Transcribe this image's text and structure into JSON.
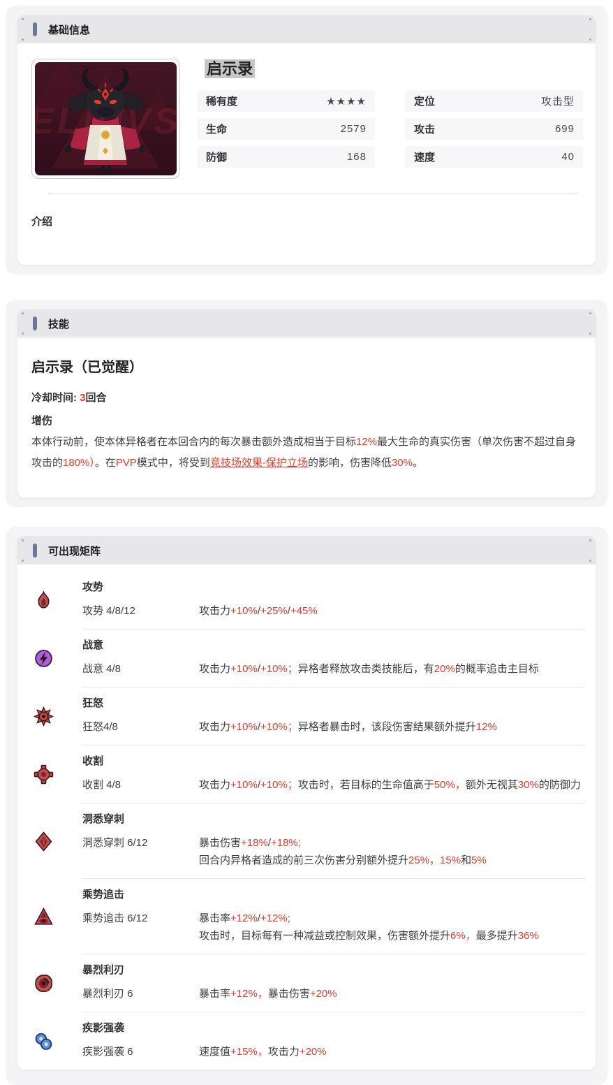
{
  "colors": {
    "accent_red": "#e8392b",
    "section_marker": "#6b7898",
    "name_highlight": "#c7c7c7",
    "header_strip": "#e7e7ea"
  },
  "basic_info": {
    "section_title": "基础信息",
    "name": "启示录",
    "portrait": {
      "watermark": "ELIUVS"
    },
    "stats_left": [
      {
        "label": "稀有度",
        "value": "★★★★"
      },
      {
        "label": "生命",
        "value": "2579"
      },
      {
        "label": "防御",
        "value": "168"
      }
    ],
    "stats_right": [
      {
        "label": "定位",
        "value": "攻击型"
      },
      {
        "label": "攻击",
        "value": "699"
      },
      {
        "label": "速度",
        "value": "40"
      }
    ],
    "intro_label": "介绍"
  },
  "skill": {
    "section_title": "技能",
    "name": "启示录（已觉醒）",
    "cooldown_label": "冷却时间:",
    "cooldown_value": "3",
    "cooldown_unit": "回合",
    "type_tag": "增伤",
    "description": [
      {
        "t": "本体行动前，使本体异格者在本回合内的每次暴击额外造成相当于目标",
        "s": "n"
      },
      {
        "t": "12%",
        "s": "r"
      },
      {
        "t": "最大生命的真实伤害（单次伤害不超过自身攻击的",
        "s": "n"
      },
      {
        "t": "180%）",
        "s": "r"
      },
      {
        "t": "。在",
        "s": "n"
      },
      {
        "t": "PVP",
        "s": "r"
      },
      {
        "t": "模式中，将受到",
        "s": "n"
      },
      {
        "t": "竞技场效果-保护立场",
        "s": "l"
      },
      {
        "t": "的影响，伤害降低",
        "s": "n"
      },
      {
        "t": "30%",
        "s": "r"
      },
      {
        "t": "。",
        "s": "n"
      }
    ]
  },
  "matrices": {
    "section_title": "可出现矩阵",
    "items": [
      {
        "name": "攻势",
        "icon": "flame-icon",
        "label": "攻势 4/8/12",
        "lines": [
          [
            {
              "t": "攻击力",
              "s": "n"
            },
            {
              "t": "+10%",
              "s": "r"
            },
            {
              "t": "/",
              "s": "n"
            },
            {
              "t": "+25%",
              "s": "r"
            },
            {
              "t": "/",
              "s": "n"
            },
            {
              "t": "+45%",
              "s": "r"
            }
          ]
        ]
      },
      {
        "name": "战意",
        "icon": "lightning-icon",
        "label": "战意 4/8",
        "lines": [
          [
            {
              "t": "攻击力",
              "s": "n"
            },
            {
              "t": "+10%",
              "s": "r"
            },
            {
              "t": "/",
              "s": "n"
            },
            {
              "t": "+10%；",
              "s": "r"
            },
            {
              "t": "异格者释放攻击类技能后，有",
              "s": "n"
            },
            {
              "t": "20%",
              "s": "r"
            },
            {
              "t": "的概率追击主目标",
              "s": "n"
            }
          ]
        ]
      },
      {
        "name": "狂怒",
        "icon": "burst-icon",
        "label": "狂怒4/8",
        "lines": [
          [
            {
              "t": "攻击力",
              "s": "n"
            },
            {
              "t": "+10%",
              "s": "r"
            },
            {
              "t": "/",
              "s": "n"
            },
            {
              "t": "+10%；",
              "s": "r"
            },
            {
              "t": "异格者暴击时，该段伤害结果额外提升",
              "s": "n"
            },
            {
              "t": "12%",
              "s": "r"
            }
          ]
        ]
      },
      {
        "name": "收割",
        "icon": "reticle-icon",
        "label": "收割 4/8",
        "lines": [
          [
            {
              "t": "攻击力",
              "s": "n"
            },
            {
              "t": "+10%",
              "s": "r"
            },
            {
              "t": "/",
              "s": "n"
            },
            {
              "t": "+10%；",
              "s": "r"
            },
            {
              "t": "攻击时，若目标的生命值高于",
              "s": "n"
            },
            {
              "t": "50%，",
              "s": "r"
            },
            {
              "t": "额外无视其",
              "s": "n"
            },
            {
              "t": "30%",
              "s": "r"
            },
            {
              "t": "的防御力",
              "s": "n"
            }
          ]
        ]
      },
      {
        "name": "洞悉穿刺",
        "icon": "kite-icon",
        "label": "洞悉穿刺 6/12",
        "lines": [
          [
            {
              "t": "暴击伤害",
              "s": "n"
            },
            {
              "t": "+18%",
              "s": "r"
            },
            {
              "t": "/",
              "s": "n"
            },
            {
              "t": "+18%;",
              "s": "r"
            }
          ],
          [
            {
              "t": "回合内异格者造成的前三次伤害分别额外提升",
              "s": "n"
            },
            {
              "t": "25%，",
              "s": "r"
            },
            {
              "t": "15%",
              "s": "r"
            },
            {
              "t": "和",
              "s": "n"
            },
            {
              "t": "5%",
              "s": "r"
            }
          ]
        ]
      },
      {
        "name": "乘势追击",
        "icon": "eye-triangle-icon",
        "label": "乘势追击 6/12",
        "lines": [
          [
            {
              "t": "暴击率",
              "s": "n"
            },
            {
              "t": "+12%",
              "s": "r"
            },
            {
              "t": "/",
              "s": "n"
            },
            {
              "t": "+12%;",
              "s": "r"
            }
          ],
          [
            {
              "t": "攻击时，目标每有一种减益或控制效果，伤害额外提升",
              "s": "n"
            },
            {
              "t": "6%，",
              "s": "r"
            },
            {
              "t": "最多提升",
              "s": "n"
            },
            {
              "t": "36%",
              "s": "r"
            }
          ]
        ]
      },
      {
        "name": "暴烈利刃",
        "icon": "swirl-icon",
        "label": "暴烈利刃 6",
        "lines": [
          [
            {
              "t": "暴击率",
              "s": "n"
            },
            {
              "t": "+12%，",
              "s": "r"
            },
            {
              "t": "暴击伤害",
              "s": "n"
            },
            {
              "t": "+20%",
              "s": "r"
            }
          ]
        ]
      },
      {
        "name": "疾影强袭",
        "icon": "double-ring-icon",
        "label": "疾影强袭 6",
        "lines": [
          [
            {
              "t": "速度值",
              "s": "n"
            },
            {
              "t": "+15%，",
              "s": "r"
            },
            {
              "t": "攻击力",
              "s": "n"
            },
            {
              "t": "+20%",
              "s": "r"
            }
          ]
        ]
      }
    ]
  }
}
